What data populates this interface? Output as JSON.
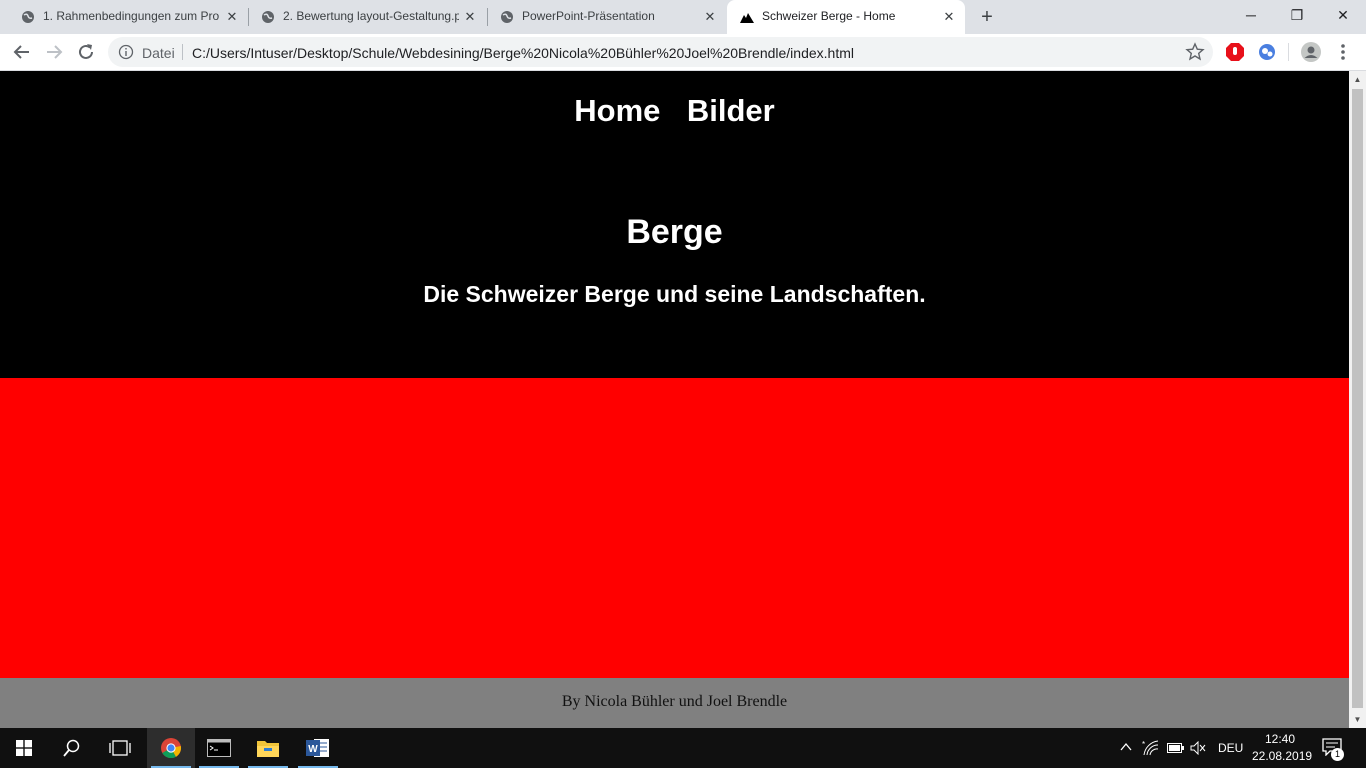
{
  "browser": {
    "tabs": [
      {
        "title": "1. Rahmenbedingungen zum Pro",
        "active": false
      },
      {
        "title": "2. Bewertung layout-Gestaltung.p",
        "active": false
      },
      {
        "title": "PowerPoint-Präsentation",
        "active": false
      },
      {
        "title": "Schweizer Berge - Home",
        "active": true
      }
    ],
    "new_tab_label": "+",
    "window_controls": {
      "minimize": "─",
      "restore": "❐",
      "close": "✕"
    },
    "address_bar": {
      "scheme_label": "Datei",
      "url": "C:/Users/Intuser/Desktop/Schule/Webdesining/Berge%20Nicola%20Bühler%20Joel%20Brendle/index.html"
    }
  },
  "page": {
    "nav": {
      "home": "Home",
      "bilder": "Bilder"
    },
    "hero": {
      "title": "Berge",
      "subtitle": "Die Schweizer Berge und seine Landschaften."
    },
    "footer": {
      "text": "By Nicola Bühler und Joel Brendle"
    },
    "colors": {
      "header_bg": "#000000",
      "content_bg": "#ff0000",
      "footer_bg": "#808080"
    }
  },
  "taskbar": {
    "apps": [
      "start-icon",
      "search-icon",
      "task-view-icon",
      "chrome-icon",
      "terminal-icon",
      "file-explorer-icon",
      "word-icon"
    ],
    "tray": {
      "language": "DEU",
      "time": "12:40",
      "date": "22.08.2019",
      "notification_count": "1"
    }
  }
}
